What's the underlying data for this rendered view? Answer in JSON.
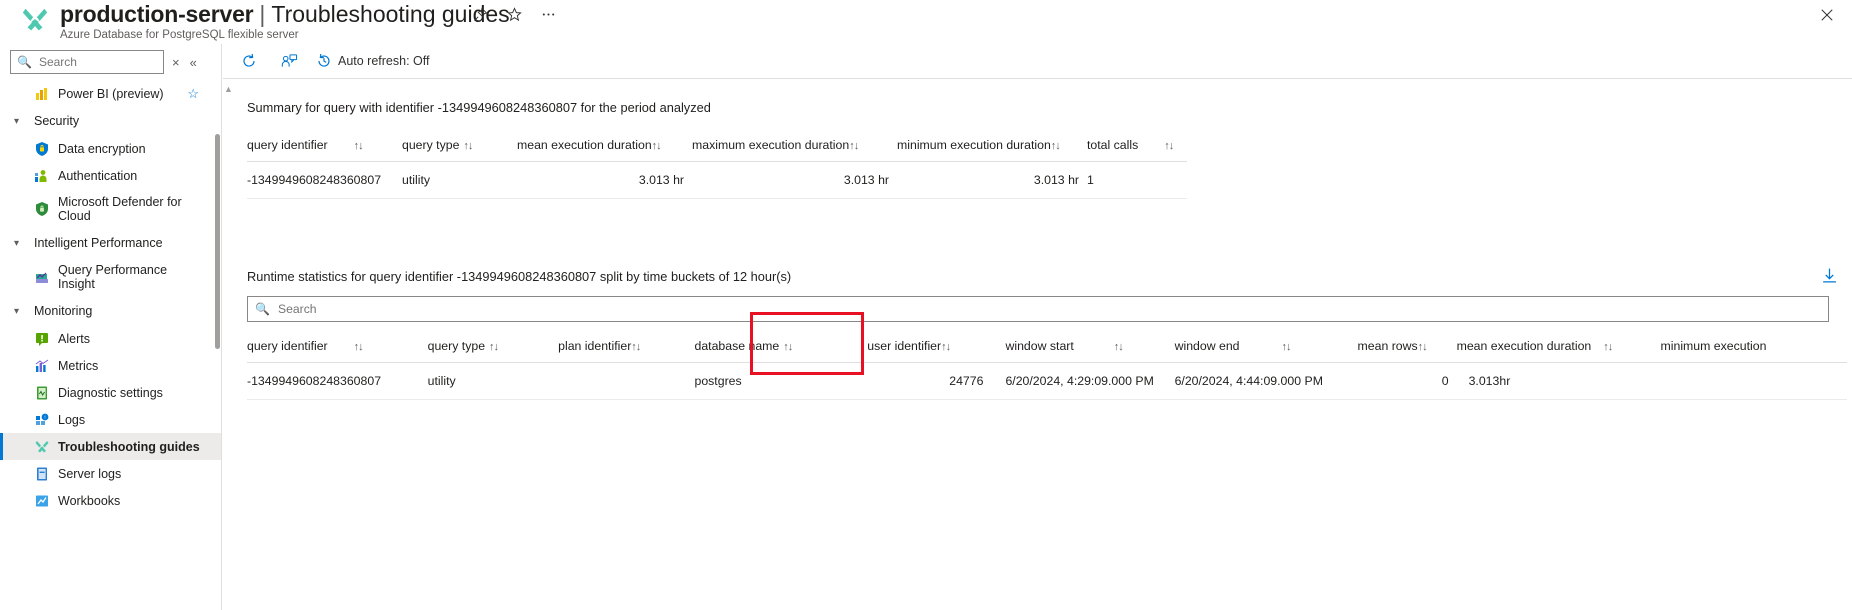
{
  "header": {
    "resource_name": "production-server",
    "separator": "|",
    "blade_name": "Troubleshooting guides",
    "subtitle": "Azure Database for PostgreSQL flexible server",
    "icons": {
      "resource": "wrench-screwdriver-icon",
      "pin": "pin-icon",
      "favorite": "star-icon",
      "more": "ellipsis-icon",
      "close": "close-icon"
    }
  },
  "leftnav": {
    "search_placeholder": "Search",
    "clear_label": "×",
    "collapse_label": "«",
    "items": [
      {
        "label": "Power BI (preview)",
        "icon": "power-bi-icon",
        "type": "item",
        "favorited": true
      },
      {
        "label": "Security",
        "icon": "chevron-down-icon",
        "type": "group"
      },
      {
        "label": "Data encryption",
        "icon": "key-shield-icon",
        "type": "item"
      },
      {
        "label": "Authentication",
        "icon": "authentication-icon",
        "type": "item"
      },
      {
        "label": "Microsoft Defender for Cloud",
        "icon": "defender-shield-icon",
        "type": "item",
        "two_line": true
      },
      {
        "label": "Intelligent Performance",
        "icon": "chevron-down-icon",
        "type": "group"
      },
      {
        "label": "Query Performance Insight",
        "icon": "query-insight-icon",
        "type": "item",
        "two_line": true
      },
      {
        "label": "Monitoring",
        "icon": "chevron-down-icon",
        "type": "group"
      },
      {
        "label": "Alerts",
        "icon": "alerts-icon",
        "type": "item"
      },
      {
        "label": "Metrics",
        "icon": "metrics-icon",
        "type": "item"
      },
      {
        "label": "Diagnostic settings",
        "icon": "diagnostic-settings-icon",
        "type": "item"
      },
      {
        "label": "Logs",
        "icon": "logs-icon",
        "type": "item"
      },
      {
        "label": "Troubleshooting guides",
        "icon": "wrench-screwdriver-icon",
        "type": "item",
        "selected": true
      },
      {
        "label": "Server logs",
        "icon": "server-logs-icon",
        "type": "item"
      },
      {
        "label": "Workbooks",
        "icon": "workbooks-icon",
        "type": "item"
      }
    ]
  },
  "commandbar": {
    "refresh_label": "",
    "refresh_icon": "refresh-icon",
    "feedback_icon": "feedback-person-icon",
    "autorefresh_icon": "clock-history-icon",
    "autorefresh_label": "Auto refresh: Off"
  },
  "summary_section": {
    "title": "Summary for query with identifier -1349949608248360807 for the period analyzed",
    "columns": [
      {
        "label": "query identifier",
        "sortable": true,
        "align": "left"
      },
      {
        "label": "query type",
        "sortable": true,
        "align": "left"
      },
      {
        "label": "mean execution duration",
        "sortable": true,
        "align": "right"
      },
      {
        "label": "maximum execution duration",
        "sortable": true,
        "align": "right"
      },
      {
        "label": "minimum execution duration",
        "sortable": true,
        "align": "right"
      },
      {
        "label": "total calls",
        "sortable": true,
        "align": "left"
      }
    ],
    "rows": [
      {
        "query_identifier": "-1349949608248360807",
        "query_type": "utility",
        "mean_execution_duration": "3.013 hr",
        "maximum_execution_duration": "3.013 hr",
        "minimum_execution_duration": "3.013 hr",
        "total_calls": "1"
      }
    ]
  },
  "runtime_section": {
    "title": "Runtime statistics for query identifier -1349949608248360807 split by time buckets of 12 hour(s)",
    "download_icon": "download-icon",
    "search_placeholder": "Search",
    "columns": [
      {
        "label": "query identifier",
        "sortable": true,
        "align": "left"
      },
      {
        "label": "query type",
        "sortable": true,
        "align": "left"
      },
      {
        "label": "plan identifier",
        "sortable": true,
        "align": "left"
      },
      {
        "label": "database name",
        "sortable": true,
        "align": "left"
      },
      {
        "label": "user identifier",
        "sortable": true,
        "align": "right",
        "highlighted": true
      },
      {
        "label": "window start",
        "sortable": true,
        "align": "left"
      },
      {
        "label": "window end",
        "sortable": true,
        "align": "left"
      },
      {
        "label": "mean rows",
        "sortable": true,
        "align": "right"
      },
      {
        "label": "mean execution duration",
        "sortable": true,
        "align": "left"
      },
      {
        "label": "minimum execution",
        "sortable": false,
        "align": "left"
      }
    ],
    "rows": [
      {
        "query_identifier": "-1349949608248360807",
        "query_type": "utility",
        "plan_identifier": "",
        "database_name": "postgres",
        "user_identifier": "24776",
        "window_start": "6/20/2024, 4:29:09.000 PM",
        "window_end": "6/20/2024, 4:44:09.000 PM",
        "mean_rows": "0",
        "mean_execution_duration": "3.013hr",
        "minimum_execution": ""
      }
    ]
  },
  "annotation": {
    "highlight_color": "#e81123",
    "highlight_target": "user identifier column"
  }
}
